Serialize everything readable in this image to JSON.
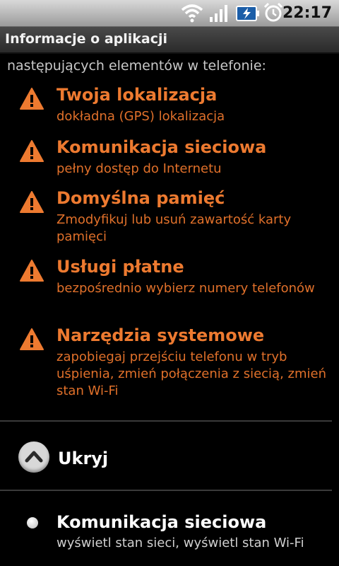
{
  "status_bar": {
    "time": "22:17",
    "icons": [
      "wifi-icon",
      "signal-icon",
      "battery-charging-icon",
      "alarm-icon"
    ]
  },
  "title_bar": {
    "title": "Informacje o aplikacji"
  },
  "intro_text": "następujących elementów w telefonie:",
  "permissions": [
    {
      "title": "Twoja lokalizacja",
      "description": "dokładna (GPS) lokalizacja",
      "icon": "warning-icon"
    },
    {
      "title": "Komunikacja sieciowa",
      "description": "pełny dostęp do Internetu",
      "icon": "warning-icon"
    },
    {
      "title": "Domyślna pamięć",
      "description": "Zmodyfikuj lub usuń zawartość karty pamięci",
      "icon": "warning-icon"
    },
    {
      "title": "Usługi płatne",
      "description": "bezpośrednio wybierz numery telefonów",
      "icon": "warning-icon"
    },
    {
      "title": "Narzędzia systemowe",
      "description": "zapobiegaj przejściu telefonu w tryb uśpienia, zmień połączenia z siecią, zmień stan Wi-Fi",
      "icon": "warning-icon"
    }
  ],
  "collapse": {
    "label": "Ukryj",
    "icon": "chevron-up-icon"
  },
  "normal_permissions": [
    {
      "title": "Komunikacja sieciowa",
      "description": "wyświetl stan sieci, wyświetl stan Wi-Fi"
    }
  ],
  "colors": {
    "warning": "#ed7a30",
    "title_bar": "#3a3a3a",
    "status_bar": "#c0c0c0",
    "background": "#000000"
  }
}
